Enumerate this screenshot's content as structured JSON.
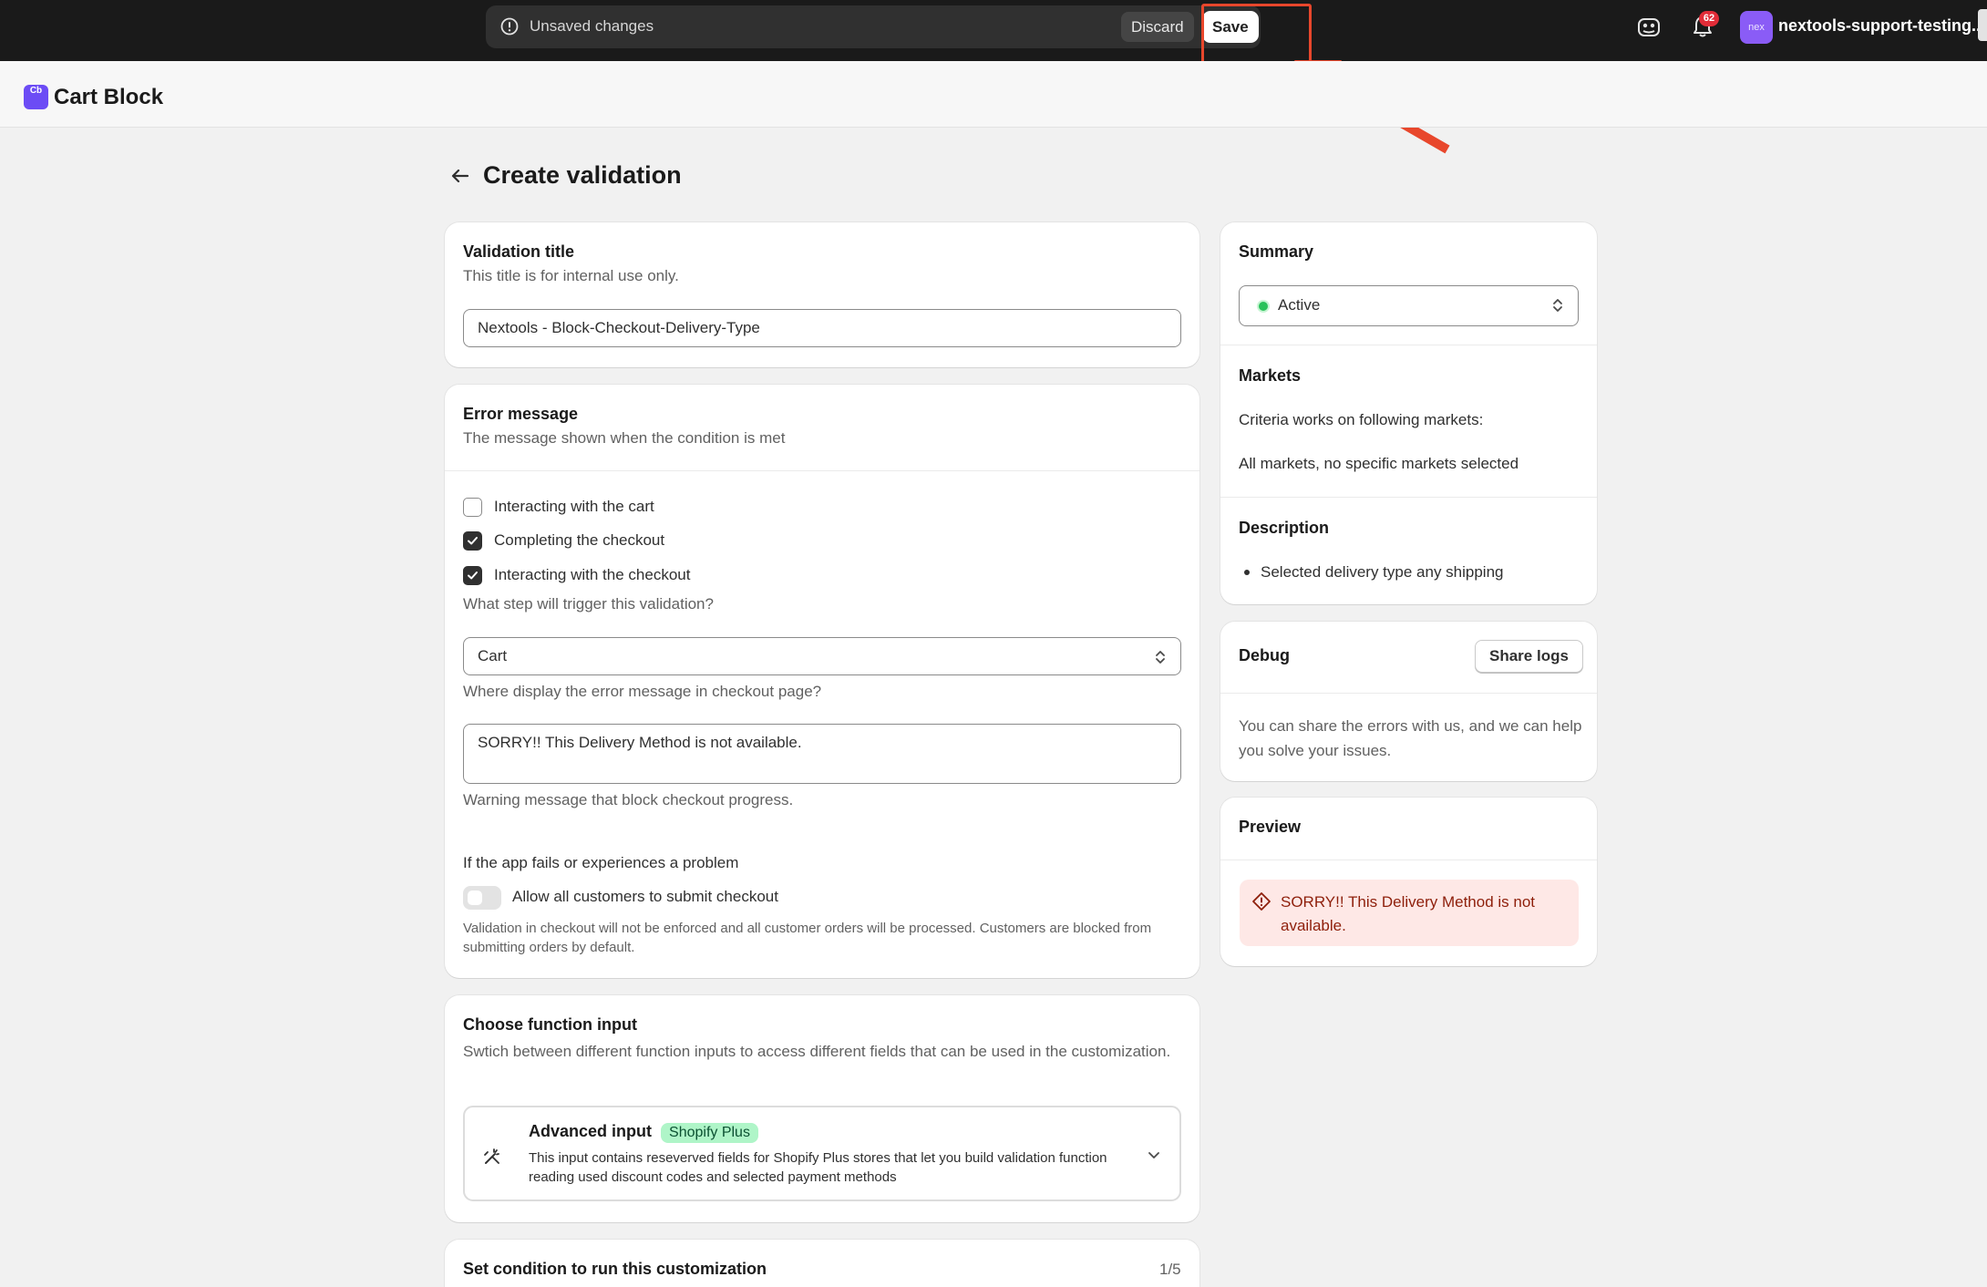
{
  "topbar": {
    "unsaved_text": "Unsaved changes",
    "discard_label": "Discard",
    "save_label": "Save",
    "notification_count": "62",
    "avatar_initials": "nex",
    "store_name": "nextools-support-testing..."
  },
  "app": {
    "logo_text": "Cb",
    "title": "Cart Block"
  },
  "page": {
    "title": "Create validation"
  },
  "validation_title_card": {
    "title": "Validation title",
    "subtitle": "This title is for internal use only.",
    "input_value": "Nextools - Block-Checkout-Delivery-Type"
  },
  "error_message_card": {
    "title": "Error message",
    "subtitle": "The message shown when the condition is met",
    "checkboxes": [
      {
        "label": "Interacting with the cart",
        "checked": false
      },
      {
        "label": "Completing the checkout",
        "checked": true
      },
      {
        "label": "Interacting with the checkout",
        "checked": true
      }
    ],
    "trigger_help": "What step will trigger this validation?",
    "location_select_value": "Cart",
    "location_help": "Where display the error message in checkout page?",
    "message_value": "SORRY!! This Delivery Method is not available.",
    "message_help": "Warning message that block checkout progress.",
    "failure_heading": "If the app fails or experiences a problem",
    "toggle_label": "Allow all customers to submit checkout",
    "toggle_on": false,
    "toggle_help": "Validation in checkout will not be enforced and all customer orders will be processed. Customers are blocked from submitting orders by default."
  },
  "function_input_card": {
    "title": "Choose function input",
    "subtitle": "Swtich between different function inputs to access different fields that can be used in the customization.",
    "option_title": "Advanced input",
    "option_badge": "Shopify Plus",
    "option_description": "This input contains reseverved fields for Shopify Plus stores that let you build validation function reading used discount codes and selected payment methods"
  },
  "condition_card": {
    "title": "Set condition to run this customization",
    "counter": "1/5"
  },
  "summary_card": {
    "title": "Summary",
    "status_value": "Active",
    "markets_title": "Markets",
    "markets_intro": "Criteria works on following markets:",
    "markets_value": "All markets, no specific markets selected",
    "description_title": "Description",
    "description_items": [
      "Selected delivery type any shipping"
    ]
  },
  "debug_card": {
    "title": "Debug",
    "share_logs_label": "Share logs",
    "body": "You can share the errors with us, and we can help you solve your issues."
  },
  "preview_card": {
    "title": "Preview",
    "error_text": "SORRY!! This Delivery Method is not available."
  },
  "colors": {
    "topbar": "#1a1a1a",
    "annotation": "#e8472c",
    "brand": "#6c4cf5",
    "success": "#29c25a",
    "critical_bg": "#fee8e6",
    "critical_text": "#8e1f0b"
  }
}
